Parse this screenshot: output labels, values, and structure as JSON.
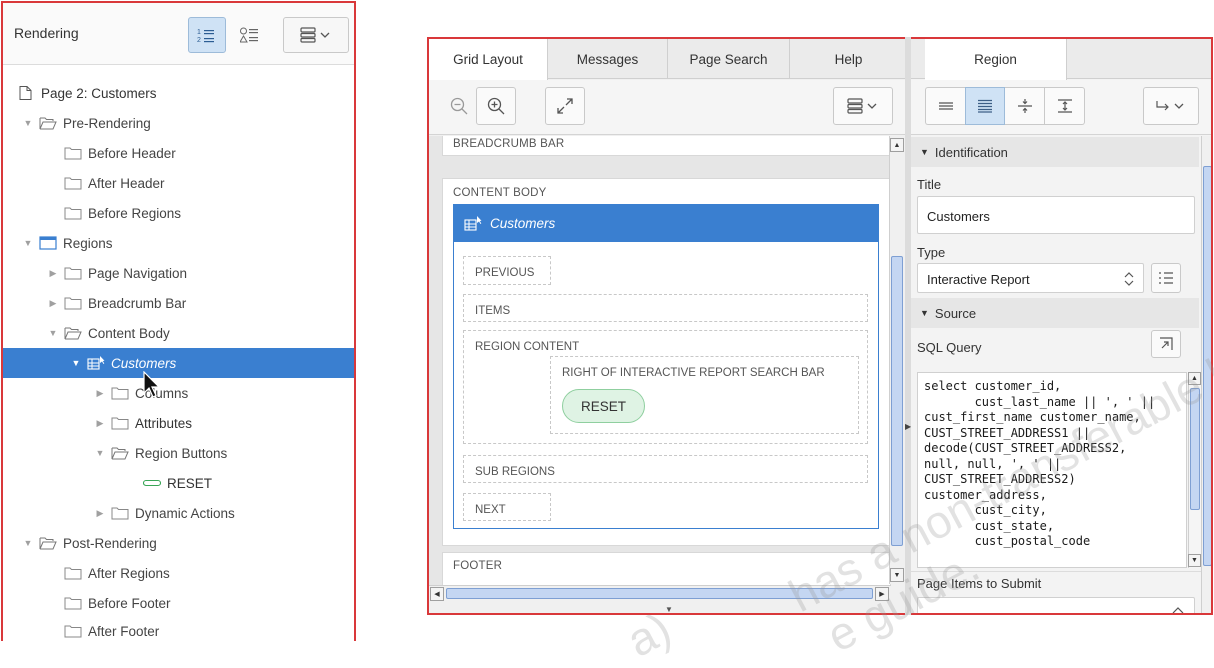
{
  "left_panel": {
    "title": "Rendering",
    "tree": [
      {
        "label": "Page 2: Customers"
      },
      {
        "label": "Pre-Rendering"
      },
      {
        "label": "Before Header"
      },
      {
        "label": "After Header"
      },
      {
        "label": "Before Regions"
      },
      {
        "label": "Regions"
      },
      {
        "label": "Page Navigation"
      },
      {
        "label": "Breadcrumb Bar"
      },
      {
        "label": "Content Body"
      },
      {
        "label": "Customers"
      },
      {
        "label": "Columns"
      },
      {
        "label": "Attributes"
      },
      {
        "label": "Region Buttons"
      },
      {
        "label": "RESET"
      },
      {
        "label": "Dynamic Actions"
      },
      {
        "label": "Post-Rendering"
      },
      {
        "label": "After Regions"
      },
      {
        "label": "Before Footer"
      },
      {
        "label": "After Footer"
      }
    ]
  },
  "center_panel": {
    "tabs": [
      "Grid Layout",
      "Messages",
      "Page Search",
      "Help"
    ],
    "active_tab": "Grid Layout",
    "breadcrumb_bar_label": "BREADCRUMB BAR",
    "content_body_label": "CONTENT BODY",
    "region_title": "Customers",
    "slots": {
      "previous": "PREVIOUS",
      "items": "ITEMS",
      "region_content": "REGION CONTENT",
      "right_of_ir": "RIGHT OF INTERACTIVE REPORT SEARCH BAR",
      "reset_button": "RESET",
      "sub_regions": "SUB REGIONS",
      "next": "NEXT"
    },
    "footer_label": "FOOTER"
  },
  "right_panel": {
    "tab": "Region",
    "identification_header": "Identification",
    "title_label": "Title",
    "title_value": "Customers",
    "type_label": "Type",
    "type_value": "Interactive Report",
    "source_header": "Source",
    "sql_query_label": "SQL Query",
    "sql_query": "select customer_id,\n       cust_last_name || ', ' ||\ncust_first_name customer_name,\nCUST_STREET_ADDRESS1 ||\ndecode(CUST_STREET_ADDRESS2,\nnull, null, ', ' ||\nCUST_STREET_ADDRESS2)\ncustomer_address,\n       cust_city,\n       cust_state,\n       cust_postal_code",
    "page_items_label": "Page Items to Submit"
  },
  "watermark": "has a non-transferable li",
  "watermark_2": "e guide.",
  "watermark_3": "a)",
  "colors": {
    "selection": "#3a7fd0",
    "region_header": "#3a7fd0",
    "border_highlight": "#d9383a",
    "reset_button": "#dff3e4"
  }
}
